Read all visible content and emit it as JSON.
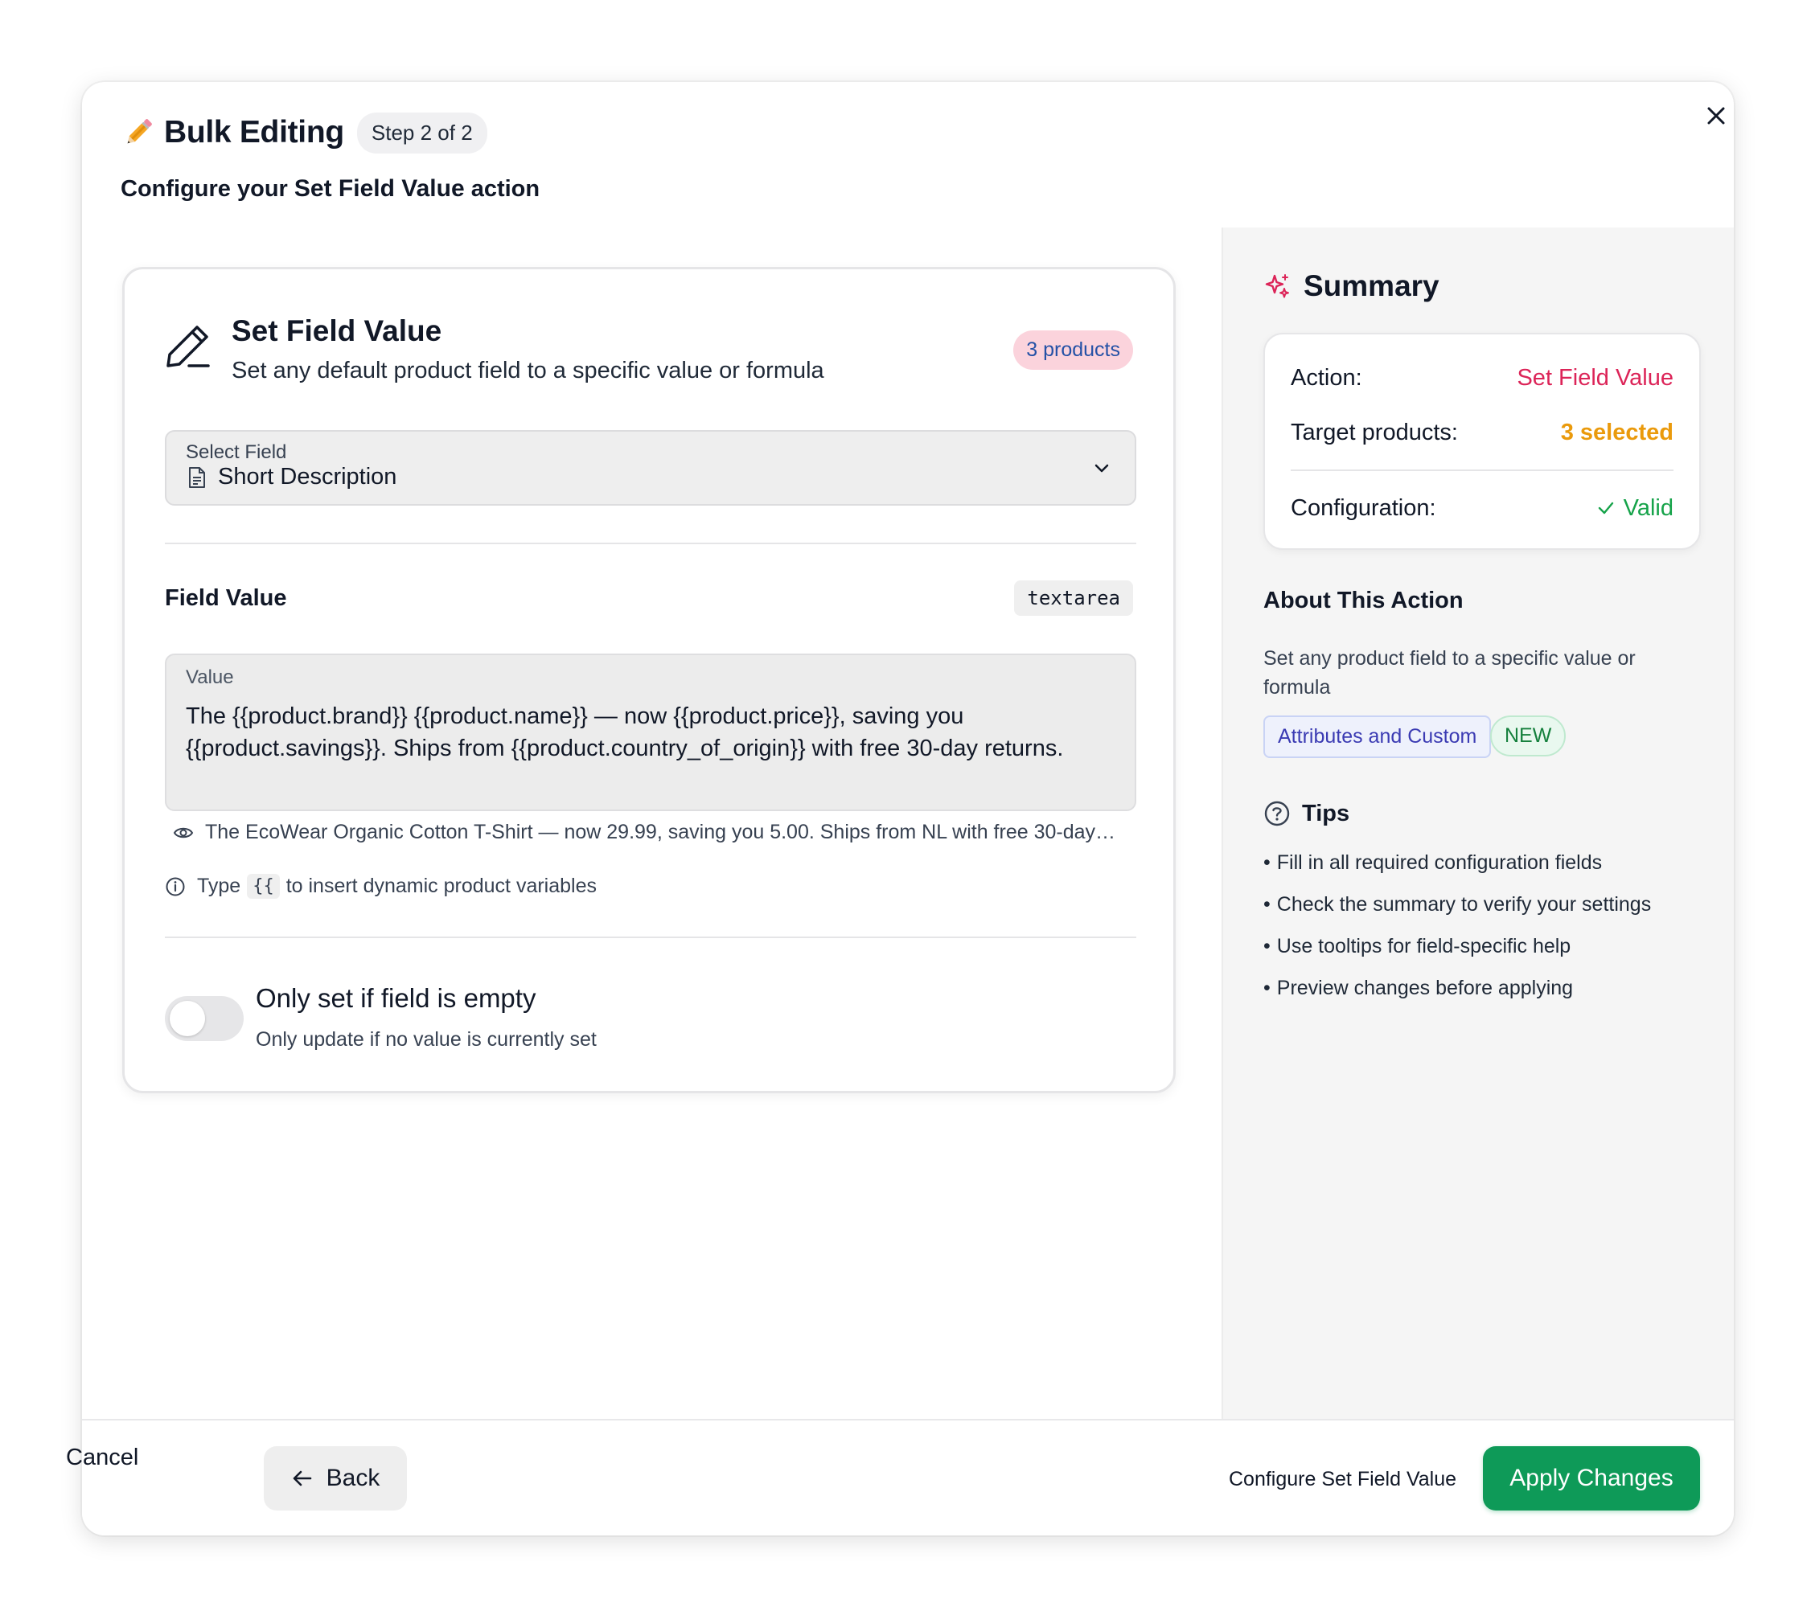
{
  "header": {
    "title": "Bulk Editing",
    "step_badge": "Step 2 of 2",
    "subtitle_prefix": "Configure your ",
    "subtitle_action": "Set Field Value",
    "subtitle_suffix": " action",
    "close_icon": "close-icon"
  },
  "action_card": {
    "title": "Set Field Value",
    "description": "Set any default product field to a specific value or formula",
    "products_badge": "3 products",
    "select_field": {
      "label": "Select Field",
      "value": "Short Description"
    },
    "field_value": {
      "label": "Field Value",
      "type_badge": "textarea",
      "input_label": "Value",
      "input_value": "The {{product.brand}} {{product.name}} — now {{product.price}}, saving you {{product.savings}}. Ships from {{product.country_of_origin}} with free 30-day returns.",
      "preview": "The EcoWear Organic Cotton T-Shirt — now 29.99, saving you 5.00. Ships from NL with free 30-day…",
      "hint_prefix": "Type",
      "hint_code": "{{",
      "hint_suffix": "to insert dynamic product variables"
    },
    "toggle": {
      "title": "Only set if field is empty",
      "description": "Only update if no value is currently set",
      "checked": false
    }
  },
  "summary": {
    "title": "Summary",
    "rows": [
      {
        "key": "Action:",
        "value": "Set Field Value"
      },
      {
        "key": "Target products:",
        "value": "3 selected"
      },
      {
        "key": "Configuration:",
        "value": "Valid"
      }
    ],
    "colors": {
      "action": "#dc2458",
      "target": "#ea9a0c",
      "valid": "#16a34a"
    }
  },
  "about": {
    "title": "About This Action",
    "description": "Set any product field to a specific value or formula",
    "category_badge": "Attributes and Custom",
    "new_badge": "NEW"
  },
  "tips": {
    "title": "Tips",
    "items": [
      "Fill in all required configuration fields",
      "Check the summary to verify your settings",
      "Use tooltips for field-specific help",
      "Preview changes before applying"
    ]
  },
  "footer": {
    "cancel_label": "Cancel",
    "back_label": "Back",
    "configure_text": "Configure Set Field Value",
    "apply_label": "Apply Changes",
    "apply_color": "#0e9a58"
  }
}
